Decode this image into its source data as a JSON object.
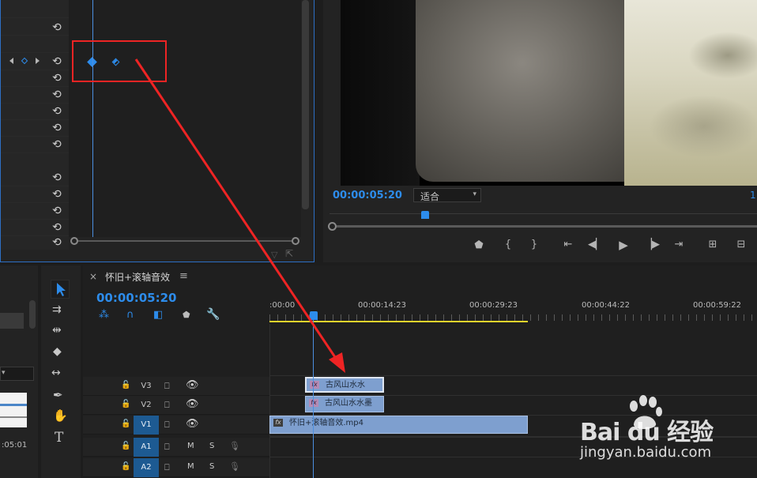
{
  "effect_controls": {
    "reset_icon": "reset-icon",
    "rows": 14
  },
  "program_monitor": {
    "timecode": "00:00:05:20",
    "fit_option": "适合",
    "side_value": "1"
  },
  "timeline": {
    "sequence_name": "怀旧+滚轴音效",
    "close_glyph": "×",
    "menu_glyph": "≡",
    "timecode": "00:00:05:20",
    "ruler": [
      ":00:00",
      "00:00:14:23",
      "00:00:29:23",
      "00:00:44:22",
      "00:00:59:22"
    ],
    "tracks": {
      "v3": "V3",
      "v2": "V2",
      "v1": "V1",
      "a1": "A1",
      "a2": "A2",
      "mute": "M",
      "solo": "S"
    },
    "clips": {
      "v3_clip": "古风山水水",
      "v2_clip": "古风山水水墨",
      "v1_clip": "怀旧+滚轴音效.mp4"
    }
  },
  "left_panel": {
    "timecode_fragment": ":05:01"
  },
  "watermark": {
    "brand": "Bai du 经验",
    "url": "jingyan.baidu.com"
  },
  "colors": {
    "accent_blue": "#2d8ceb",
    "playhead": "#4b8fe0",
    "annotation_red": "#ee2424",
    "work_area": "#e2d42c"
  }
}
